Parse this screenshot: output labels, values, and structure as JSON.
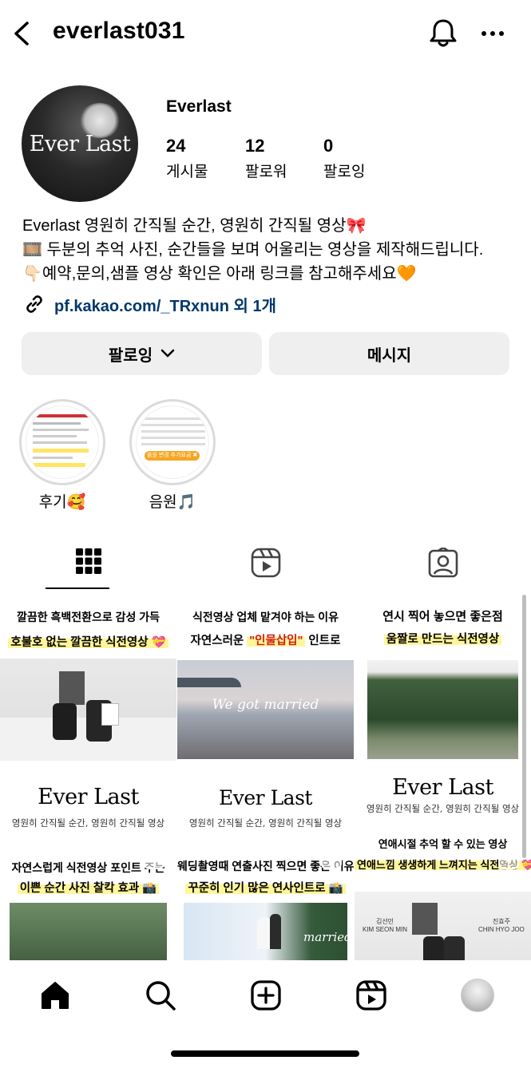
{
  "header": {
    "username": "everlast031"
  },
  "profile": {
    "avatar_text": "Ever Last",
    "display_name": "Everlast",
    "stats": [
      {
        "value": "24",
        "label": "게시물"
      },
      {
        "value": "12",
        "label": "팔로워"
      },
      {
        "value": "0",
        "label": "팔로잉"
      }
    ],
    "bio": [
      "Everlast 영원히 간직될 순간, 영원히 간직될 영상🎀",
      "🎞️ 두분의 추억 사진, 순간들을 보며 어울리는 영상을 제작해드립니다.",
      "👇🏻예약,문의,샘플 영상 확인은 아래 링크를 참고해주세요🧡"
    ],
    "link": "pf.kakao.com/_TRxnun 외 1개"
  },
  "actions": {
    "follow_label": "팔로잉",
    "message_label": "메시지"
  },
  "highlights": [
    {
      "label": "후기🥰",
      "badge": ""
    },
    {
      "label": "음원🎵",
      "badge": "음원 변경 추가요금 ✖"
    }
  ],
  "posts": [
    {
      "cap1": "깔끔한 흑백전환으로 감성 가득",
      "cap2": "호불호 없는 깔끔한 식전영상 💝"
    },
    {
      "cap1": "식전영상 업체 맡겨야 하는 이유",
      "cap2a": "자연스러운 ",
      "cap2b": "\"인물삽입\"",
      "cap2c": " 인트로",
      "photo_text": "We got married"
    },
    {
      "cap1": "연시 찍어 놓으면 좋은점",
      "cap2": "움짤로 만드는 식전영상"
    },
    {
      "brand": "Ever Last",
      "sub": "영원히 간직될 순간, 영원히 간직될 영상",
      "cap1": "자연스럽게 식전영상 포인트 주는",
      "cap2": "이쁜 순간 사진 찰칵 효과 📸"
    },
    {
      "brand": "Ever Last",
      "sub": "영원히 간직될 순간, 영원히 간직될 영상",
      "cap1": "웨딩촬영때 연출사진 찍으면 좋은 이유",
      "cap2": "꾸준히 인기 많은 연사인트로 📸",
      "photo_text": "married"
    },
    {
      "brand": "Ever Last",
      "sub": "영원히 간직될 순간, 영원히 간직될 영상",
      "cap1": "연애시절 추억 할 수 있는 영상",
      "cap2": "연애느낌 생생하게 느껴지는 식전영상 💝",
      "name1": "김선민",
      "name1_en": "KIM SEON MIN",
      "name2": "진효주",
      "name2_en": "CHIN HYO JOO"
    }
  ],
  "colors": {
    "link": "#00376b",
    "button_bg": "#efefef",
    "highlight": "#fff59a"
  }
}
